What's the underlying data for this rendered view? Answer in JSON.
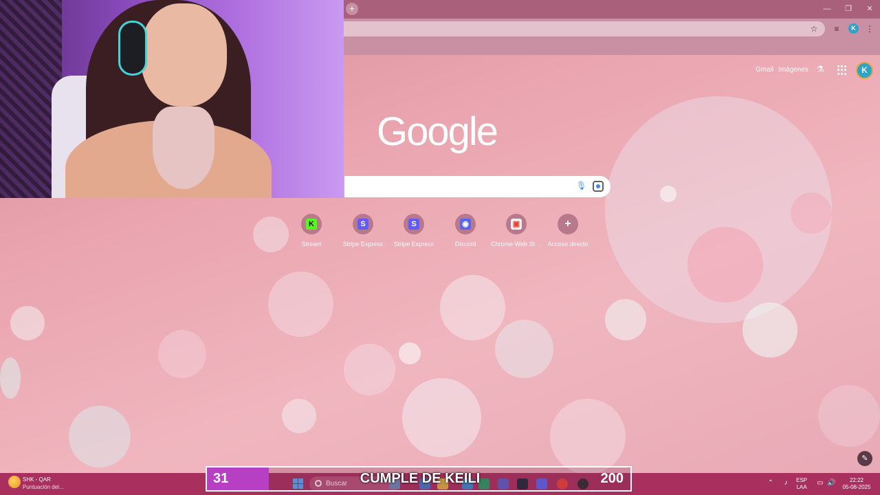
{
  "browser": {
    "toolbar_icons": [
      "star-icon",
      "media-controls-icon",
      "profile-icon",
      "menu-icon"
    ],
    "profile_initial": "K",
    "window_controls": [
      "minimize-icon",
      "restore-icon",
      "close-icon"
    ]
  },
  "ntp": {
    "gmail": "Gmail",
    "images": "Imágenes",
    "profile_initial": "K",
    "logo": "Google",
    "shortcuts": [
      {
        "label": "Stream",
        "glyph": "K",
        "color": "#53fc18",
        "glyph_color": "#111111"
      },
      {
        "label": "Stripe Express",
        "glyph": "S",
        "color": "#635bff",
        "glyph_color": "#ffffff"
      },
      {
        "label": "Stripe Express",
        "glyph": "S",
        "color": "#635bff",
        "glyph_color": "#ffffff"
      },
      {
        "label": "Discord",
        "glyph": "◉",
        "color": "#5865f2",
        "glyph_color": "#ffffff"
      },
      {
        "label": "Chrome Web Store",
        "glyph": "▣",
        "color": "#f1f1f1",
        "glyph_color": "#e94235"
      },
      {
        "label": "Acceso directo",
        "glyph": "+",
        "color": "transparent",
        "glyph_color": "#ffffff"
      }
    ]
  },
  "overlay": {
    "left_number": "31",
    "title": "CUMPLE DE KEILI",
    "right_number": "200",
    "accent": "#b63fc4"
  },
  "taskbar": {
    "weather_title": "SHK - QAR",
    "weather_sub": "Puntuación del...",
    "search_placeholder": "Buscar",
    "lang_top": "ESP",
    "lang_bottom": "LAA",
    "time": "22:22",
    "date": "05-08-2025"
  }
}
